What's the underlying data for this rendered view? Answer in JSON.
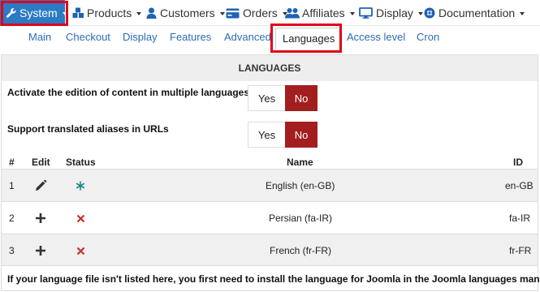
{
  "menu": [
    {
      "label": "System",
      "icon": "wrench-icon"
    },
    {
      "label": "Products",
      "icon": "cubes-icon"
    },
    {
      "label": "Customers",
      "icon": "user-icon"
    },
    {
      "label": "Orders",
      "icon": "credit-card-icon"
    },
    {
      "label": "Affiliates",
      "icon": "users-icon"
    },
    {
      "label": "Display",
      "icon": "monitor-icon"
    },
    {
      "label": "Documentation",
      "icon": "life-ring-icon"
    }
  ],
  "tabs": [
    "Main",
    "Checkout",
    "Display",
    "Features",
    "Advanced",
    "Languages",
    "Access level",
    "Cron"
  ],
  "panel": {
    "title": "LANGUAGES",
    "settings": [
      {
        "label": "Activate the edition of content in multiple languages",
        "yes": "Yes",
        "no": "No",
        "value": "No"
      },
      {
        "label": "Support translated aliases in URLs",
        "yes": "Yes",
        "no": "No",
        "value": "No"
      }
    ],
    "columns": [
      "#",
      "Edit",
      "Status",
      "Name",
      "ID"
    ],
    "rows": [
      {
        "num": "1",
        "edit": "pencil-icon",
        "status": "default-asterisk-icon",
        "name": "English (en-GB)",
        "id": "en-GB"
      },
      {
        "num": "2",
        "edit": "plus-icon",
        "status": "x-icon",
        "name": "Persian (fa-IR)",
        "id": "fa-IR"
      },
      {
        "num": "3",
        "edit": "plus-icon",
        "status": "x-icon",
        "name": "French (fr-FR)",
        "id": "fr-FR"
      }
    ],
    "footer": "If your language file isn't listed here, you first need to install the language for Joomla in the Joomla languages manager."
  },
  "colors": {
    "accent": "#2a7bc4",
    "no_active": "#a31e1e",
    "link": "#2d6bb8",
    "highlight": "#e0001b",
    "status_x": "#c9302c",
    "status_default": "#1a8a8a"
  }
}
